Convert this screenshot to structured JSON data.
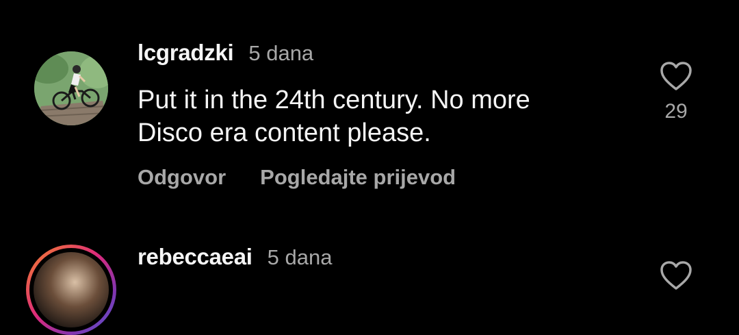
{
  "comments": [
    {
      "username": "lcgradzki",
      "time": "5 dana",
      "text_line_1": "Put it in the 24th century. No more",
      "text_line_2": "Disco era content please.",
      "likes": "29",
      "reply_label": "Odgovor",
      "translate_label": "Pogledajte prijevod",
      "avatar": "cyclist-photo"
    },
    {
      "username": "rebeccaeai",
      "time": "5 dana",
      "avatar": "profile-photo-with-story-ring"
    }
  ],
  "icons": {
    "like": "heart-outline-icon"
  },
  "colors": {
    "background": "#000000",
    "primary_text": "#f5f5f5",
    "secondary_text": "#a8a8a8",
    "story_ring": [
      "#f58529",
      "#dd2a7b",
      "#8134af",
      "#515bd4"
    ]
  }
}
